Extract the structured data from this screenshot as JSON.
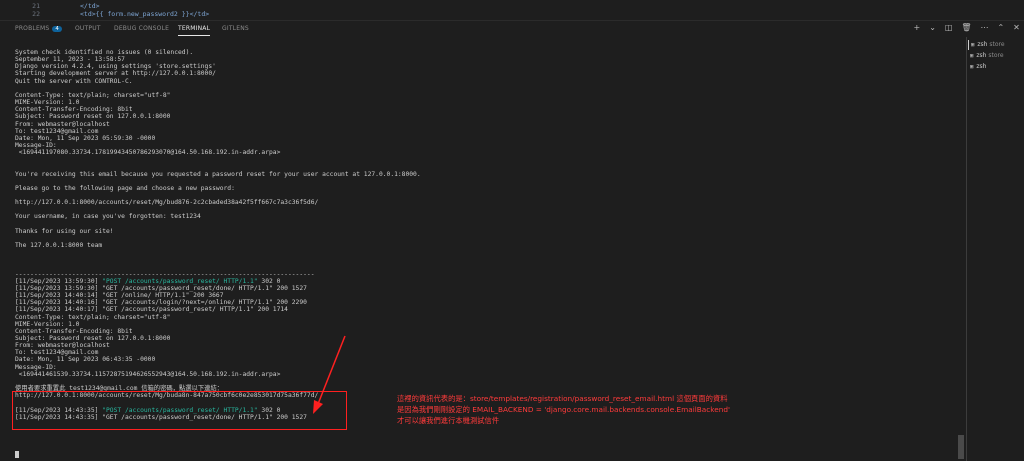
{
  "editor": {
    "lines": [
      {
        "number": "21",
        "code": "</td>"
      },
      {
        "number": "22",
        "code": "<td>{{ form.new_password2 }}</td>"
      }
    ]
  },
  "panel": {
    "tabs": [
      {
        "label": "PROBLEMS",
        "badge": "4"
      },
      {
        "label": "OUTPUT"
      },
      {
        "label": "DEBUG CONSOLE"
      },
      {
        "label": "TERMINAL",
        "active": true
      },
      {
        "label": "GITLENS"
      }
    ],
    "tool_icons": [
      "plus-icon",
      "chevron-down-icon",
      "split-icon",
      "trash-icon",
      "ellipsis-icon",
      "maximize-icon",
      "close-icon"
    ]
  },
  "terminal": {
    "lines": [
      "System check identified no issues (0 silenced).",
      "September 11, 2023 - 13:58:57",
      "Django version 4.2.4, using settings 'store.settings'",
      "Starting development server at http://127.0.0.1:8000/",
      "Quit the server with CONTROL-C.",
      "",
      "Content-Type: text/plain; charset=\"utf-8\"",
      "MIME-Version: 1.0",
      "Content-Transfer-Encoding: 8bit",
      "Subject: Password reset on 127.0.0.1:8000",
      "From: webmaster@localhost",
      "To: test1234@gmail.com",
      "Date: Mon, 11 Sep 2023 05:59:30 -0000",
      "Message-ID:",
      " <169441197080.33734.17819943450786293070@164.50.168.192.in-addr.arpa>",
      "",
      "",
      "You're receiving this email because you requested a password reset for your user account at 127.0.0.1:8000.",
      "",
      "Please go to the following page and choose a new password:",
      "",
      "http://127.0.0.1:8000/accounts/reset/Mg/bud876-2c2cbaded38a42f5ff667c7a3c36f5d6/",
      "",
      "Your username, in case you've forgotten: test1234",
      "",
      "Thanks for using our site!",
      "",
      "The 127.0.0.1:8000 team",
      "",
      "",
      "",
      "-------------------------------------------------------------------------------",
      "[11/Sep/2023 13:59:30] \"POST /accounts/password_reset/ HTTP/1.1\" 302 0",
      "[11/Sep/2023 13:59:30] \"GET /accounts/password_reset/done/ HTTP/1.1\" 200 1527",
      "[11/Sep/2023 14:40:14] \"GET /online/ HTTP/1.1\" 200 3667",
      "[11/Sep/2023 14:40:16] \"GET /accounts/login/?next=/online/ HTTP/1.1\" 200 2290",
      "[11/Sep/2023 14:40:17] \"GET /accounts/password_reset/ HTTP/1.1\" 200 1714",
      "Content-Type: text/plain; charset=\"utf-8\"",
      "MIME-Version: 1.0",
      "Content-Transfer-Encoding: 8bit",
      "Subject: Password reset on 127.0.0.1:8000",
      "From: webmaster@localhost",
      "To: test1234@gmail.com",
      "Date: Mon, 11 Sep 2023 06:43:35 -0000",
      "Message-ID:",
      " <169441461539.33734.11572875194626552943@164.50.168.192.in-addr.arpa>",
      "",
      "使用者要求重置此 test1234@gmail.com 信箱的密碼，點選以下連結：",
      "http://127.0.0.1:8000/accounts/reset/Mg/buda8n-847a750cbf6c0e2e853017d75a36f77d/",
      "",
      "[11/Sep/2023 14:43:35] \"POST /accounts/password_reset/ HTTP/1.1\" 302 0",
      "[11/Sep/2023 14:43:35] \"GET /accounts/password_reset/done/ HTTP/1.1\" 200 1527"
    ],
    "green_lines": [
      32,
      50
    ]
  },
  "sidebar": {
    "items": [
      {
        "label": "zsh",
        "sub": "store",
        "active": true
      },
      {
        "label": "zsh",
        "sub": "store"
      },
      {
        "label": "zsh",
        "sub": ""
      }
    ]
  },
  "annotation": {
    "color": "#ff2020",
    "lines": [
      "這裡的資訊代表的是：store/templates/registration/password_reset_email.html 這個頁面的資料",
      "是因為我們剛剛設定的  EMAIL_BACKEND = 'django.core.mail.backends.console.EmailBackend'",
      "才可以讓我們進行本機測試信件"
    ]
  }
}
